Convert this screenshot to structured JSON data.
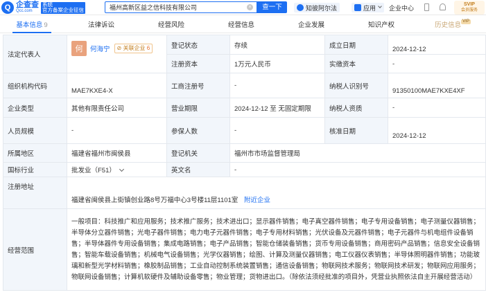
{
  "logo": {
    "main": "企查查",
    "domain": "Qcc.com",
    "badge_line1": "系统",
    "badge_line2": "官方备案企业征信"
  },
  "search": {
    "value": "福州高新区益之信科技有限公司",
    "button": "查一下"
  },
  "toolbar": {
    "zhi": "知彼阿尔法",
    "app": "应用",
    "center": "企业中心",
    "svip_line1": "SVIP",
    "svip_line2": "会员服务"
  },
  "tabs": [
    {
      "label": "基本信息",
      "count": "9"
    },
    {
      "label": "法律诉讼"
    },
    {
      "label": "经营风险"
    },
    {
      "label": "经营信息"
    },
    {
      "label": "企业发展"
    },
    {
      "label": "知识产权"
    },
    {
      "label": "历史信息",
      "badge": "VIP"
    }
  ],
  "info": {
    "legal_rep_label": "法定代表人",
    "legal_rep_avatar": "何",
    "legal_rep_name": "何海宁",
    "related_label": "关联企业",
    "related_count": "6",
    "status_label": "登记状态",
    "status_value": "存续",
    "est_date_label": "成立日期",
    "est_date_value": "2024-12-12",
    "capital_label": "注册资本",
    "capital_value": "1万元人民币",
    "paid_label": "实缴资本",
    "paid_value": "-",
    "org_code_label": "组织机构代码",
    "org_code_value": "MAE7KXE4-X",
    "biz_no_label": "工商注册号",
    "biz_no_value": "-",
    "tax_id_label": "纳税人识别号",
    "tax_id_value": "91350100MAE7KXE4XF",
    "type_label": "企业类型",
    "type_value": "其他有限责任公司",
    "term_label": "营业期限",
    "term_value": "2024-12-12 至 无固定期限",
    "tax_qual_label": "纳税人资质",
    "tax_qual_value": "-",
    "staff_label": "人员规模",
    "staff_value": "-",
    "insured_label": "参保人数",
    "insured_value": "-",
    "approve_label": "核准日期",
    "approve_value": "2024-12-12",
    "region_label": "所属地区",
    "region_value": "福建省福州市闽侯县",
    "authority_label": "登记机关",
    "authority_value": "福州市市场监督管理局",
    "industry_label": "国标行业",
    "industry_value": "批发业（F51）",
    "en_name_label": "英文名",
    "en_name_value": "-",
    "address_label": "注册地址",
    "address_value": "福建省闽侯县上街镇创业路8号万福中心3号楼11层1101室",
    "nearby_label": "附近企业",
    "scope_label": "经营范围",
    "scope_value": "一般项目：科技推广和应用服务；技术推广服务；技术进出口；显示器件销售；电子真空器件销售；电子专用设备销售；电子测量仪器销售；半导体分立器件销售；光电子器件销售；电力电子元器件销售；电子专用材料销售；光伏设备及元器件销售；电子元器件与机电组件设备销售；半导体器件专用设备销售；集成电路销售；电子产品销售；智能仓储装备销售；货币专用设备销售；商用密码产品销售；信息安全设备销售；智能车载设备销售；机械电气设备销售；光学仪器销售；绘图、计算及测量仪器销售；电工仪器仪表销售；半导体照明器件销售；功能玻璃和新型光学材料销售；橡胶制品销售；工业自动控制系统装置销售；通信设备销售；物联网技术服务；物联网技术研发；物联网应用服务；物联网设备销售；计算机软硬件及辅助设备零售；物业管理；货物进出口。（除依法须经批准的项目外，凭营业执照依法自主开展经营活动）"
  }
}
